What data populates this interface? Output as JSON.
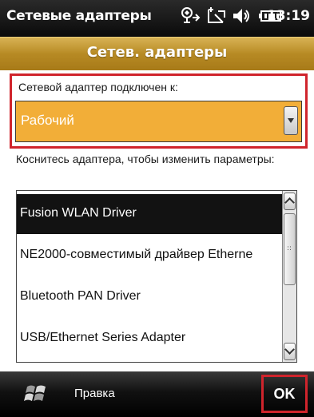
{
  "status_bar": {
    "title": "Сетевые адаптеры",
    "time": "13:19",
    "icons": [
      "connectivity-icon",
      "signal-icon",
      "volume-icon",
      "battery-icon"
    ]
  },
  "header": {
    "title": "Сетев. адаптеры"
  },
  "adapter_section": {
    "label": "Сетевой адаптер подключен к:",
    "selected_value": "Рабочий"
  },
  "instruction": "Коснитесь адаптера, чтобы изменить параметры:",
  "adapter_list": {
    "items": [
      {
        "label": "Fusion WLAN  Driver",
        "selected": true
      },
      {
        "label": "NE2000-совместимый драйвер Etherne",
        "selected": false
      },
      {
        "label": "Bluetooth PAN Driver",
        "selected": false
      },
      {
        "label": "USB/Ethernet Series Adapter",
        "selected": false
      }
    ]
  },
  "bottom_bar": {
    "left_menu": "Правка",
    "right_button": "OK"
  },
  "colors": {
    "header_gold": "#b78a24",
    "select_orange": "#f2ae38",
    "highlight_red": "#d0242c",
    "selected_row": "#121212"
  }
}
